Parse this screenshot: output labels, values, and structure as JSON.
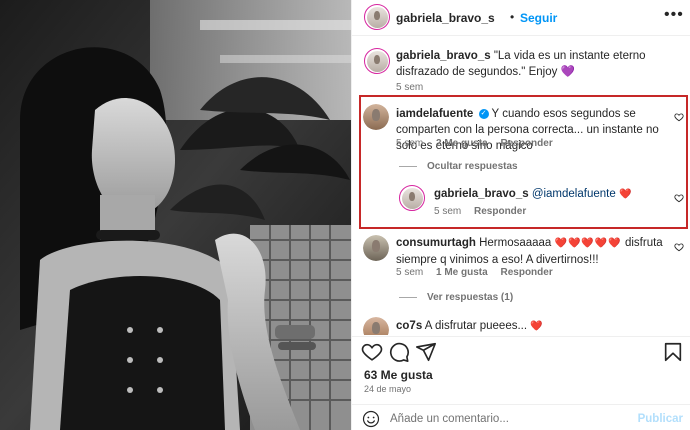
{
  "post": {
    "author": "gabriela_bravo_s",
    "separator": "•",
    "follow_label": "Seguir",
    "more_label": "•••"
  },
  "caption": {
    "username": "gabriela_bravo_s",
    "text": "\"La vida es un instante eterno disfrazado de segundos.\" Enjoy",
    "emoji": "💜",
    "time": "5 sem"
  },
  "comments": [
    {
      "username": "iamdelafuente",
      "verified": true,
      "text": "Y cuando esos segundos se comparten con la persona correcta... un instante no solo es eterno sino mágico",
      "time": "5 sem",
      "likes": "2 Me gusta",
      "reply_label": "Responder",
      "hide_replies_label": "Ocultar respuestas",
      "replies": [
        {
          "username": "gabriela_bravo_s",
          "mention": "@iamdelafuente",
          "emoji": "❤️",
          "time": "5 sem",
          "reply_label": "Responder"
        }
      ]
    },
    {
      "username": "consumurtagh",
      "text_before": "Hermosaaaaa",
      "hearts": "❤️❤️❤️❤️❤️",
      "text_after": "disfruta siempre q vinimos a eso! A divertirnos!!!",
      "time": "5 sem",
      "likes": "1 Me gusta",
      "reply_label": "Responder",
      "view_replies_label": "Ver respuestas (1)"
    },
    {
      "username": "co7s",
      "text": "A disfrutar pueees...",
      "emoji": "❤️"
    }
  ],
  "likes_count": "63 Me gusta",
  "date": "24 de mayo",
  "add_comment": {
    "placeholder": "Añade un comentario...",
    "publish_label": "Publicar"
  },
  "colors": {
    "accent_blue": "#0095f6",
    "highlight_red": "#c62828",
    "heart_red": "#ed4956"
  }
}
